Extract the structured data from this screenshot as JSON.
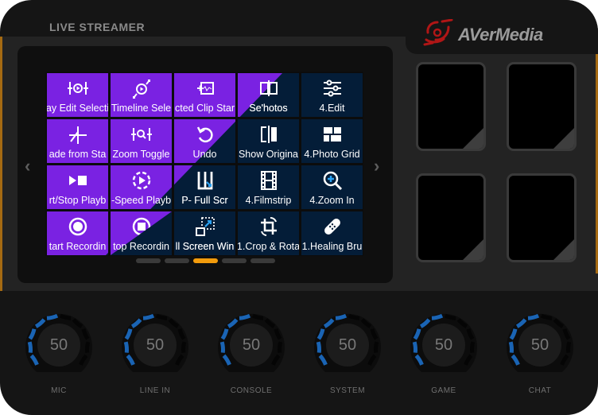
{
  "header": {
    "product_label": "LIVE STREAMER",
    "brand_logo_text": "AVerMedia"
  },
  "colors": {
    "tile_purple": "#7a22e2",
    "tile_navy": "#041d38",
    "accent_orange": "#f29b0c",
    "knob_blue": "#1a64b4",
    "logo_red": "#b01616"
  },
  "screen": {
    "tiles": [
      {
        "label": "ay Edit Selecti",
        "icon": "play-edit-selection-icon",
        "style": "purple"
      },
      {
        "label": "Timeline Sele",
        "icon": "timeline-select-icon",
        "style": "purple"
      },
      {
        "label": "cted Clip Star",
        "icon": "selected-clip-start-icon",
        "style": "purple"
      },
      {
        "label": "Se'hotos",
        "icon": "separate-photos-icon",
        "style": "split"
      },
      {
        "label": "4.Edit",
        "icon": "sliders-icon",
        "style": "navy"
      },
      {
        "label": "ade from Sta",
        "icon": "fade-icon",
        "style": "purple"
      },
      {
        "label": "Zoom Toggle",
        "icon": "zoom-toggle-icon",
        "style": "purple"
      },
      {
        "label": "Undo",
        "icon": "undo-icon",
        "style": "purple"
      },
      {
        "label": "Show Origina",
        "icon": "compare-icon",
        "style": "navy"
      },
      {
        "label": "4.Photo Grid",
        "icon": "photo-grid-icon",
        "style": "navy"
      },
      {
        "label": "rt/Stop Playb",
        "icon": "play-stop-icon",
        "style": "purple"
      },
      {
        "label": "-Speed Playb",
        "icon": "speed-play-icon",
        "style": "purple"
      },
      {
        "label": "P- Full Scr",
        "icon": "full-screen-icon",
        "style": "split"
      },
      {
        "label": "4.Filmstrip",
        "icon": "filmstrip-icon",
        "style": "navy"
      },
      {
        "label": "4.Zoom In",
        "icon": "zoom-in-icon",
        "style": "navy"
      },
      {
        "label": "tart Recordin",
        "icon": "record-start-icon",
        "style": "purple"
      },
      {
        "label": "top Recordin",
        "icon": "record-stop-icon",
        "style": "purple"
      },
      {
        "label": "ll Screen Win",
        "icon": "window-resize-icon",
        "style": "split"
      },
      {
        "label": "1.Crop & Rota",
        "icon": "crop-rotate-icon",
        "style": "navy"
      },
      {
        "label": "1.Healing Bru",
        "icon": "bandage-icon",
        "style": "navy"
      }
    ],
    "page_count": 5,
    "active_page": 3
  },
  "knobs": [
    {
      "label": "MIC",
      "value": "50"
    },
    {
      "label": "LINE IN",
      "value": "50"
    },
    {
      "label": "CONSOLE",
      "value": "50"
    },
    {
      "label": "SYSTEM",
      "value": "50"
    },
    {
      "label": "GAME",
      "value": "50"
    },
    {
      "label": "CHAT",
      "value": "50"
    }
  ]
}
